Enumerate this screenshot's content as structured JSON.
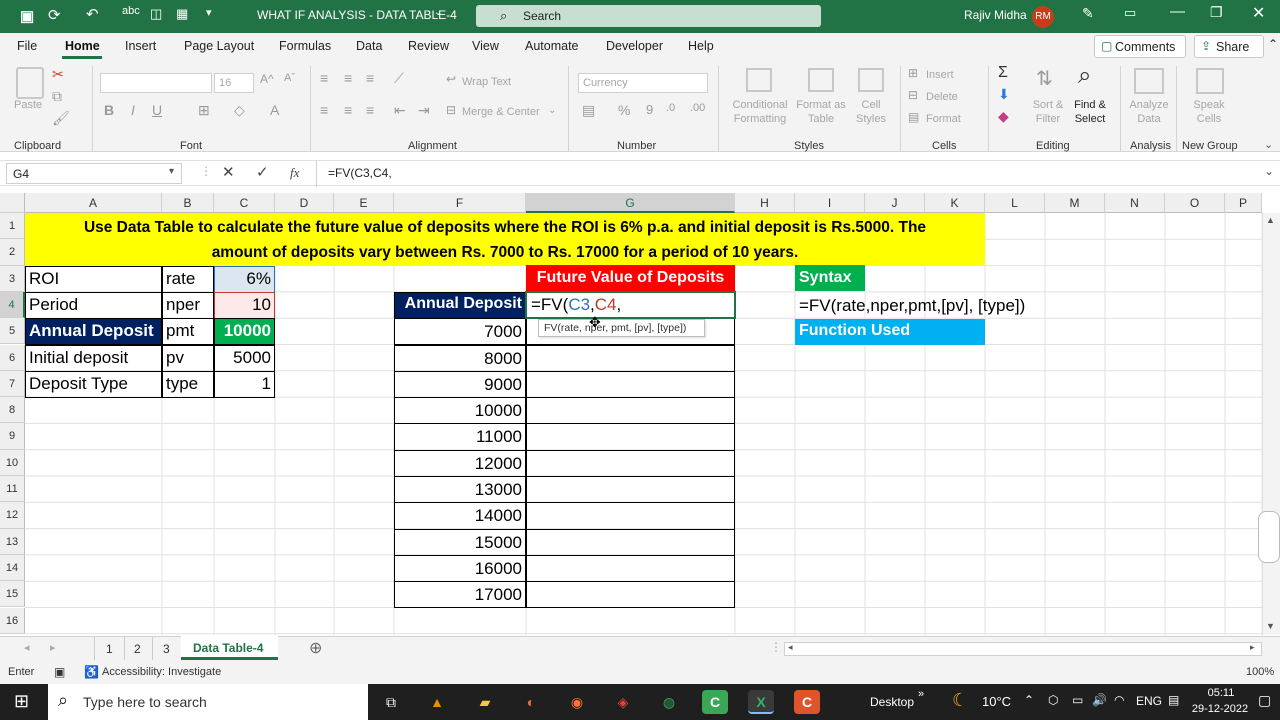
{
  "titlebar": {
    "document_title": "WHAT IF ANALYSIS - DATA TABLE-4",
    "search_placeholder": "Search",
    "user_name": "Rajiv Midha",
    "user_initials": "RM"
  },
  "menu": {
    "items": [
      "File",
      "Home",
      "Insert",
      "Page Layout",
      "Formulas",
      "Data",
      "Review",
      "View",
      "Automate",
      "Developer",
      "Help"
    ],
    "comments": "Comments",
    "share": "Share"
  },
  "ribbon": {
    "paste": "Paste",
    "clipboard": "Clipboard",
    "font_size": "16",
    "font": "Font",
    "wrap_text": "Wrap Text",
    "merge_center": "Merge & Center",
    "alignment": "Alignment",
    "number_format": "Currency",
    "number": "Number",
    "conditional_formatting": [
      "Conditional",
      "Formatting"
    ],
    "format_as_table": [
      "Format as",
      "Table"
    ],
    "cell_styles": [
      "Cell",
      "Styles"
    ],
    "styles": "Styles",
    "insert": "Insert",
    "delete": "Delete",
    "format": "Format",
    "cells": "Cells",
    "sort_filter": [
      "Sort &",
      "Filter"
    ],
    "find_select": [
      "Find &",
      "Select"
    ],
    "editing": "Editing",
    "analyze_data": [
      "Analyze",
      "Data"
    ],
    "analysis": "Analysis",
    "speak_cells": [
      "Speak",
      "Cells"
    ],
    "new_group": "New Group"
  },
  "formula_bar": {
    "name_box": "G4",
    "fx": "fx",
    "formula": "=FV(C3,C4,"
  },
  "columns": [
    "A",
    "B",
    "C",
    "D",
    "E",
    "F",
    "G",
    "H",
    "I",
    "J",
    "K",
    "L",
    "M",
    "N",
    "O",
    "P"
  ],
  "rows": [
    "1",
    "2",
    "3",
    "4",
    "5",
    "6",
    "7",
    "8",
    "9",
    "10",
    "11",
    "12",
    "13",
    "14",
    "15",
    "16"
  ],
  "cells": {
    "banner_line1": "Use Data Table to calculate the future value of deposits where the ROI is  6% p.a. and initial deposit is Rs.5000.  The",
    "banner_line2": "amount of deposits vary between Rs. 7000 to Rs. 17000 for a period of 10 years.",
    "inputs": [
      {
        "label": "ROI",
        "arg": "rate",
        "value": "6%"
      },
      {
        "label": "Period",
        "arg": "nper",
        "value": "10"
      },
      {
        "label": "Annual Deposit",
        "arg": "pmt",
        "value": "10000"
      },
      {
        "label": "Initial deposit",
        "arg": "pv",
        "value": "5000"
      },
      {
        "label": "Deposit Type",
        "arg": "type",
        "value": "1"
      }
    ],
    "fv_header": "Future Value of Deposits",
    "annual_deposit_header": "Annual Deposit",
    "editing_formula_prefix": "=FV(",
    "editing_ref1": "C3",
    "editing_ref2": "C4",
    "comma": ",",
    "tooltip": "FV(rate, nper, pmt, [pv], [type])",
    "deposits": [
      "7000",
      "8000",
      "9000",
      "10000",
      "11000",
      "12000",
      "13000",
      "14000",
      "15000",
      "16000",
      "17000"
    ],
    "syntax_label": "Syntax",
    "syntax_text": "=FV(rate,nper,pmt,[pv], [type])",
    "function_used_label": "Function Used"
  },
  "sheet_tabs": [
    "1",
    "2",
    "3",
    "Data Table-4"
  ],
  "status": {
    "mode": "Enter",
    "accessibility": "Accessibility: Investigate",
    "zoom": "100%"
  },
  "taskbar": {
    "search_placeholder": "Type here to search",
    "desktop": "Desktop",
    "temperature": "10°C",
    "language": "ENG",
    "time": "05:11",
    "date": "29-12-2022"
  },
  "colors": {
    "excel_green": "#217346",
    "banner_yellow": "#ffff00",
    "fv_header_red": "#ff0000",
    "annual_deposit_navy": "#002060",
    "syntax_green": "#00b050",
    "function_used_blue": "#00b0f0",
    "pmt_green": "#00b050"
  }
}
